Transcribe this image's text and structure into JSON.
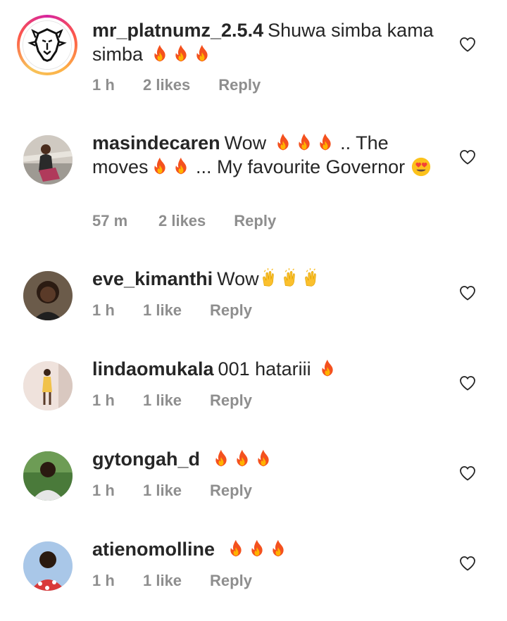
{
  "comments": [
    {
      "username": "mr_platnumz_2.5.4",
      "text": "Shuwa simba kama simba",
      "emoji_after": "🔥🔥🔥",
      "time": "1 h",
      "likes": "2 likes",
      "reply": "Reply",
      "avatar_icon": "lion-logo-icon"
    },
    {
      "username": "masindecaren",
      "text_parts": [
        "Wow",
        ".. The moves",
        "... My favourite Governor"
      ],
      "time": "57 m",
      "likes": "2 likes",
      "reply": "Reply"
    },
    {
      "username": "eve_kimanthi",
      "text": "Wow",
      "time": "1 h",
      "likes": "1 like",
      "reply": "Reply"
    },
    {
      "username": "lindaomukala",
      "text": "001 hatariii",
      "time": "1 h",
      "likes": "1 like",
      "reply": "Reply"
    },
    {
      "username": "gytongah_d",
      "text": "",
      "time": "1 h",
      "likes": "1 like",
      "reply": "Reply"
    },
    {
      "username": "atienomolline",
      "text": "",
      "time": "1 h",
      "likes": "1 like",
      "reply": "Reply"
    }
  ],
  "colors": {
    "text": "#262626",
    "meta": "#8e8e8e",
    "fire": "#f4511e"
  }
}
